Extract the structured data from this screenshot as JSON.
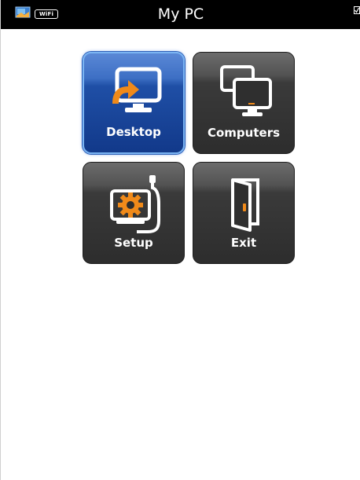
{
  "status_bar": {
    "title": "My PC",
    "wifi_label": "WiFi",
    "background_color": "#000000",
    "icons": [
      "app-icon",
      "wifi-icon",
      "checkbox-icon"
    ]
  },
  "menu": {
    "items": [
      {
        "label": "Desktop",
        "icon": "desktop-icon",
        "selected": true
      },
      {
        "label": "Computers",
        "icon": "computers-icon",
        "selected": false
      },
      {
        "label": "Setup",
        "icon": "setup-icon",
        "selected": false
      },
      {
        "label": "Exit",
        "icon": "exit-icon",
        "selected": false
      }
    ]
  },
  "colors": {
    "selected_tile": "#1f4fa6",
    "tile": "#2d2d2d",
    "accent_orange": "#f08a1a",
    "label": "#ffffff"
  }
}
